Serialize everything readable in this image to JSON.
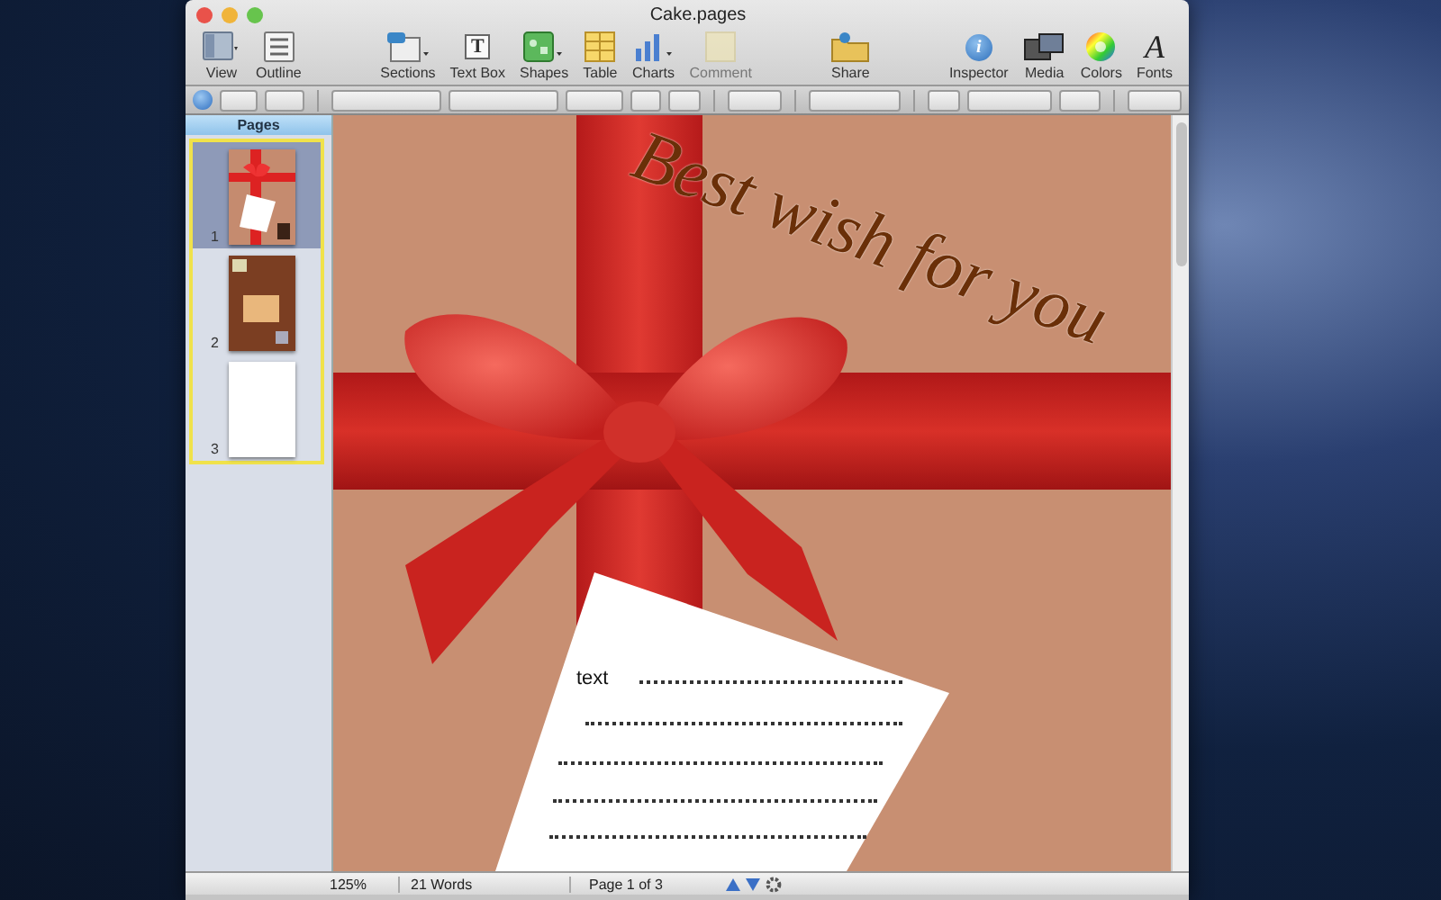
{
  "window": {
    "title": "Cake.pages"
  },
  "toolbar": {
    "items": [
      {
        "kind": "view",
        "label": "View",
        "disabled": false
      },
      {
        "kind": "outline",
        "label": "Outline",
        "disabled": false
      },
      {
        "kind": "gap"
      },
      {
        "kind": "sections",
        "label": "Sections",
        "disabled": false
      },
      {
        "kind": "textbox",
        "label": "Text Box",
        "glyph": "T",
        "disabled": false
      },
      {
        "kind": "shapes",
        "label": "Shapes",
        "disabled": false
      },
      {
        "kind": "table",
        "label": "Table",
        "disabled": false
      },
      {
        "kind": "charts",
        "label": "Charts",
        "disabled": false
      },
      {
        "kind": "comment",
        "label": "Comment",
        "disabled": true
      },
      {
        "kind": "gap"
      },
      {
        "kind": "share",
        "label": "Share",
        "disabled": false
      },
      {
        "kind": "gap"
      },
      {
        "kind": "inspector",
        "label": "Inspector",
        "glyph": "i",
        "disabled": false
      },
      {
        "kind": "media",
        "label": "Media",
        "disabled": false
      },
      {
        "kind": "colors",
        "label": "Colors",
        "disabled": false
      },
      {
        "kind": "fonts",
        "label": "Fonts",
        "glyph": "A",
        "disabled": false
      }
    ]
  },
  "sidebar": {
    "title": "Pages",
    "pages": [
      {
        "number": "1",
        "selected": true,
        "kind": "ribbon"
      },
      {
        "number": "2",
        "selected": false,
        "kind": "brown"
      },
      {
        "number": "3",
        "selected": false,
        "kind": "blank"
      }
    ]
  },
  "document": {
    "heading": "Best wish for you",
    "note_text": "text"
  },
  "status_bar": {
    "zoom": "125%",
    "words": "21 Words",
    "page": "Page 1 of 3"
  }
}
